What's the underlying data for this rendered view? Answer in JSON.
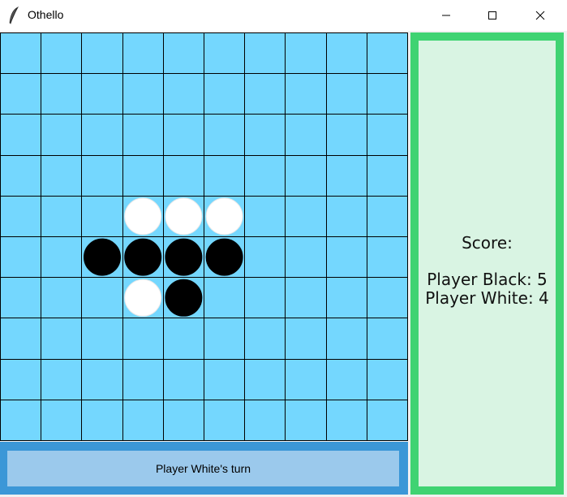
{
  "window": {
    "title": "Othello",
    "icon": "feather-icon",
    "controls": [
      "minimize-icon",
      "maximize-icon",
      "close-icon"
    ]
  },
  "board": {
    "rows": 10,
    "cols": 10,
    "board_color": "#74d7fe",
    "line_color": "#000000",
    "pieces": [
      {
        "row": 4,
        "col": 3,
        "color": "white"
      },
      {
        "row": 4,
        "col": 4,
        "color": "white"
      },
      {
        "row": 4,
        "col": 5,
        "color": "white"
      },
      {
        "row": 5,
        "col": 2,
        "color": "black"
      },
      {
        "row": 5,
        "col": 3,
        "color": "black"
      },
      {
        "row": 5,
        "col": 4,
        "color": "black"
      },
      {
        "row": 5,
        "col": 5,
        "color": "black"
      },
      {
        "row": 6,
        "col": 3,
        "color": "white"
      },
      {
        "row": 6,
        "col": 4,
        "color": "black"
      }
    ]
  },
  "status": {
    "text": "Player White's turn",
    "frame_color": "#3b97d7",
    "fill_color": "#9bc9ec"
  },
  "score": {
    "heading": "Score:",
    "black_line": "Player Black: 5",
    "white_line": "Player White: 4",
    "frame_color": "#3fd372",
    "fill_color": "#d9f4e3"
  }
}
